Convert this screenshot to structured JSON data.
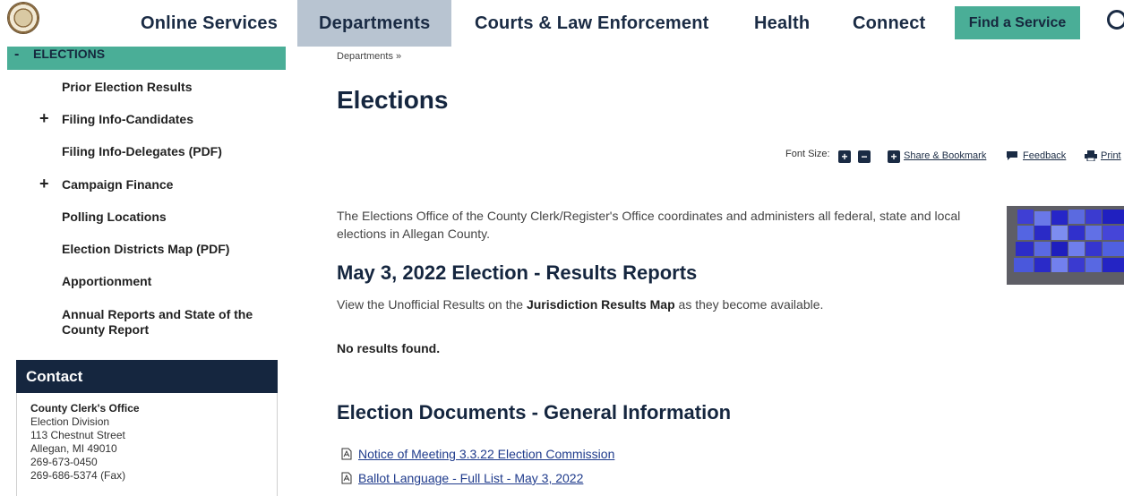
{
  "nav": {
    "items": [
      "Online Services",
      "Departments",
      "Courts & Law Enforcement",
      "Health",
      "Connect"
    ],
    "find_service": "Find a Service"
  },
  "sidebar": {
    "active_label": "ELECTIONS",
    "items": [
      {
        "label": "Prior Election Results",
        "expandable": false
      },
      {
        "label": "Filing Info-Candidates",
        "expandable": true
      },
      {
        "label": "Filing Info-Delegates (PDF)",
        "expandable": false
      },
      {
        "label": "Campaign Finance",
        "expandable": true
      },
      {
        "label": "Polling Locations",
        "expandable": false
      },
      {
        "label": "Election Districts Map (PDF)",
        "expandable": false
      },
      {
        "label": "Apportionment",
        "expandable": false
      },
      {
        "label": "Annual Reports and State of the County Report",
        "expandable": false
      }
    ]
  },
  "contact": {
    "heading": "Contact",
    "office": "County Clerk's Office",
    "division": "Election Division",
    "street": "113 Chestnut Street",
    "city": "Allegan, MI 49010",
    "phone": "269-673-0450",
    "fax": "269-686-5374 (Fax)"
  },
  "breadcrumb": "Departments »",
  "page_title": "Elections",
  "tools": {
    "font_size": "Font Size:",
    "share": "Share & Bookmark",
    "feedback": "Feedback",
    "print": "Print"
  },
  "intro": "The Elections Office of the County Clerk/Register's Office coordinates and administers all federal, state and local elections in Allegan County.",
  "results_heading": "May 3, 2022 Election - Results Reports",
  "results_text_before": "View the Unofficial Results on the ",
  "results_text_bold": "Jurisdiction Results Map",
  "results_text_after": " as they become available.",
  "no_results": "No results found.",
  "docs_heading": "Election Documents - General Information",
  "documents": [
    "Notice of Meeting 3.3.22 Election Commission",
    "Ballot Language - Full List - May 3, 2022"
  ],
  "colors": {
    "accent": "#4aae97",
    "navy": "#15263f",
    "active_nav": "#b8c4d1",
    "link": "#1f3b8c"
  }
}
